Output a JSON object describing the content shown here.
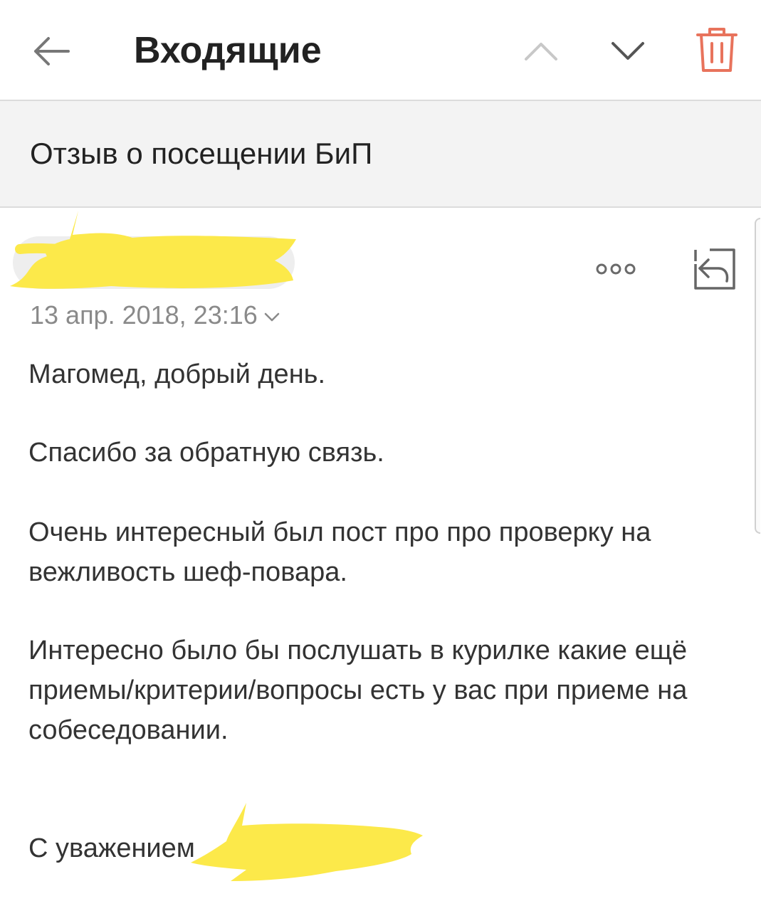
{
  "header": {
    "back_icon": "arrow-left-icon",
    "title": "Входящие",
    "prev_icon": "chevron-up-icon",
    "next_icon": "chevron-down-icon",
    "delete_icon": "trash-icon",
    "delete_color": "#e8735c"
  },
  "message": {
    "subject": "Отзыв о посещении БиП",
    "sender": "",
    "date": "13 апр. 2018, 23:16",
    "more_icon": "more-dots-icon",
    "reply_icon": "reply-icon",
    "body": {
      "greeting": "Магомед, добрый день.",
      "thanks": "Спасибо за обратную связь.",
      "paragraph1": "Очень интересный был пост про про проверку на вежливость шеф-повара.",
      "paragraph2": "Интересно было бы послушать в курилке какие ещё приемы/критерии/вопросы есть у вас при приеме на собеседовании.",
      "signoff": "С уважением"
    }
  },
  "colors": {
    "redaction": "#fce94a",
    "subject_background": "#f3f3f3"
  }
}
